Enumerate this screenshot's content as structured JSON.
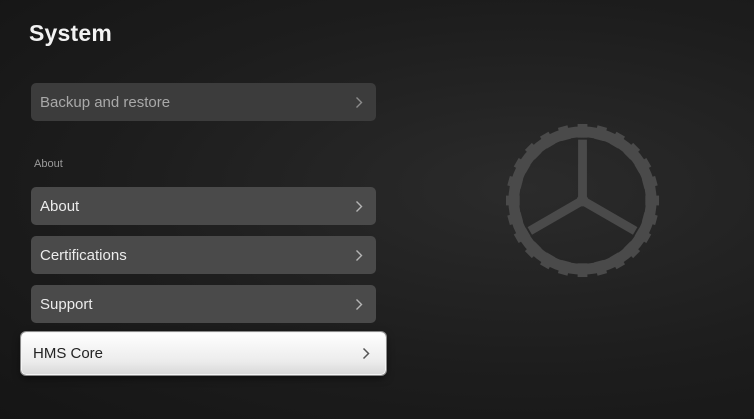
{
  "page": {
    "title": "System"
  },
  "menu": {
    "items": [
      {
        "label": "Backup and restore",
        "chevron": "chevron-right-icon"
      },
      {
        "label": "About",
        "chevron": "chevron-right-icon"
      },
      {
        "label": "Certifications",
        "chevron": "chevron-right-icon"
      },
      {
        "label": "Support",
        "chevron": "chevron-right-icon"
      },
      {
        "label": "HMS Core",
        "chevron": "chevron-right-icon"
      }
    ],
    "section_about": "About",
    "focused_index": 4
  },
  "decor": {
    "icon": "gear-icon",
    "color": "#4a4a4a"
  },
  "colors": {
    "item_bg": "#4a4a4a",
    "focused_bg": "#f0f0f0",
    "background": "#1d1d1d"
  }
}
